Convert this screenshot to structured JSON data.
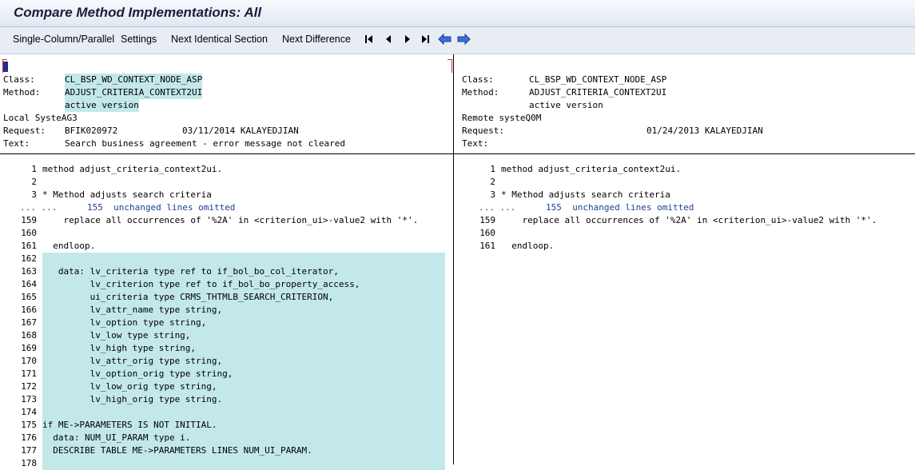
{
  "window": {
    "title": "Compare Method Implementations: All"
  },
  "toolbar": {
    "single_column_parallel": "Single-Column/Parallel",
    "settings": "Settings",
    "next_identical_section": "Next Identical Section",
    "next_difference": "Next Difference",
    "icons": [
      "first-icon",
      "previous-icon",
      "next-icon",
      "last-icon",
      "arrow-left-icon",
      "arrow-right-icon"
    ]
  },
  "left": {
    "header": {
      "class_label": "Class:",
      "class_value": "CL_BSP_WD_CONTEXT_NODE_ASP",
      "method_label": "Method:",
      "method_value": "ADJUST_CRITERIA_CONTEXT2UI",
      "version": "active version",
      "system": "Local SysteAG3",
      "request_label": "Request:",
      "request_value": "BFIK020972",
      "date_user": "03/11/2014 KALAYEDJIAN",
      "text_label": "Text:",
      "text_value": "Search business agreement - error message not cleared"
    },
    "code": [
      {
        "num": "1",
        "text": "method adjust_criteria_context2ui."
      },
      {
        "num": "2",
        "text": ""
      },
      {
        "num": "3",
        "text": "* Method adjusts search criteria"
      },
      {
        "num": "... ...",
        "text": "155  unchanged lines omitted"
      },
      {
        "num": "159",
        "text": "    replace all occurrences of '%2A' in <criterion_ui>-value2 with '*'."
      },
      {
        "num": "160",
        "text": ""
      },
      {
        "num": "161",
        "text": "  endloop."
      },
      {
        "num": "162",
        "text": ""
      },
      {
        "num": "163",
        "text": "   data: lv_criteria type ref to if_bol_bo_col_iterator,"
      },
      {
        "num": "164",
        "text": "         lv_criterion type ref to if_bol_bo_property_access,"
      },
      {
        "num": "165",
        "text": "         ui_criteria type CRMS_THTMLB_SEARCH_CRITERION,"
      },
      {
        "num": "166",
        "text": "         lv_attr_name type string,"
      },
      {
        "num": "167",
        "text": "         lv_option type string,"
      },
      {
        "num": "168",
        "text": "         lv_low type string,"
      },
      {
        "num": "169",
        "text": "         lv_high type string,"
      },
      {
        "num": "170",
        "text": "         lv_attr_orig type string,"
      },
      {
        "num": "171",
        "text": "         lv_option_orig type string,"
      },
      {
        "num": "172",
        "text": "         lv_low_orig type string,"
      },
      {
        "num": "173",
        "text": "         lv_high_orig type string."
      },
      {
        "num": "174",
        "text": ""
      },
      {
        "num": "175",
        "text": "if ME->PARAMETERS IS NOT INITIAL."
      },
      {
        "num": "176",
        "text": "  data: NUM_UI_PARAM type i."
      },
      {
        "num": "177",
        "text": "  DESCRIBE TABLE ME->PARAMETERS LINES NUM_UI_PARAM."
      },
      {
        "num": "178",
        "text": ""
      }
    ]
  },
  "right": {
    "header": {
      "class_label": "Class:",
      "class_value": "CL_BSP_WD_CONTEXT_NODE_ASP",
      "method_label": "Method:",
      "method_value": "ADJUST_CRITERIA_CONTEXT2UI",
      "version": "active version",
      "system": "Remote systeQ0M",
      "request_label": "Request:",
      "date_user": "01/24/2013 KALAYEDJIAN",
      "text_label": "Text:"
    },
    "code": [
      {
        "num": "1",
        "text": "method adjust_criteria_context2ui."
      },
      {
        "num": "2",
        "text": ""
      },
      {
        "num": "3",
        "text": "* Method adjusts search criteria"
      },
      {
        "num": "... ...",
        "text": "155  unchanged lines omitted"
      },
      {
        "num": "159",
        "text": "    replace all occurrences of '%2A' in <criterion_ui>-value2 with '*'."
      },
      {
        "num": "160",
        "text": ""
      },
      {
        "num": "161",
        "text": "  endloop."
      }
    ]
  },
  "colors": {
    "highlight": "#c3e8ea",
    "omitted_text": "#1d3f99"
  }
}
